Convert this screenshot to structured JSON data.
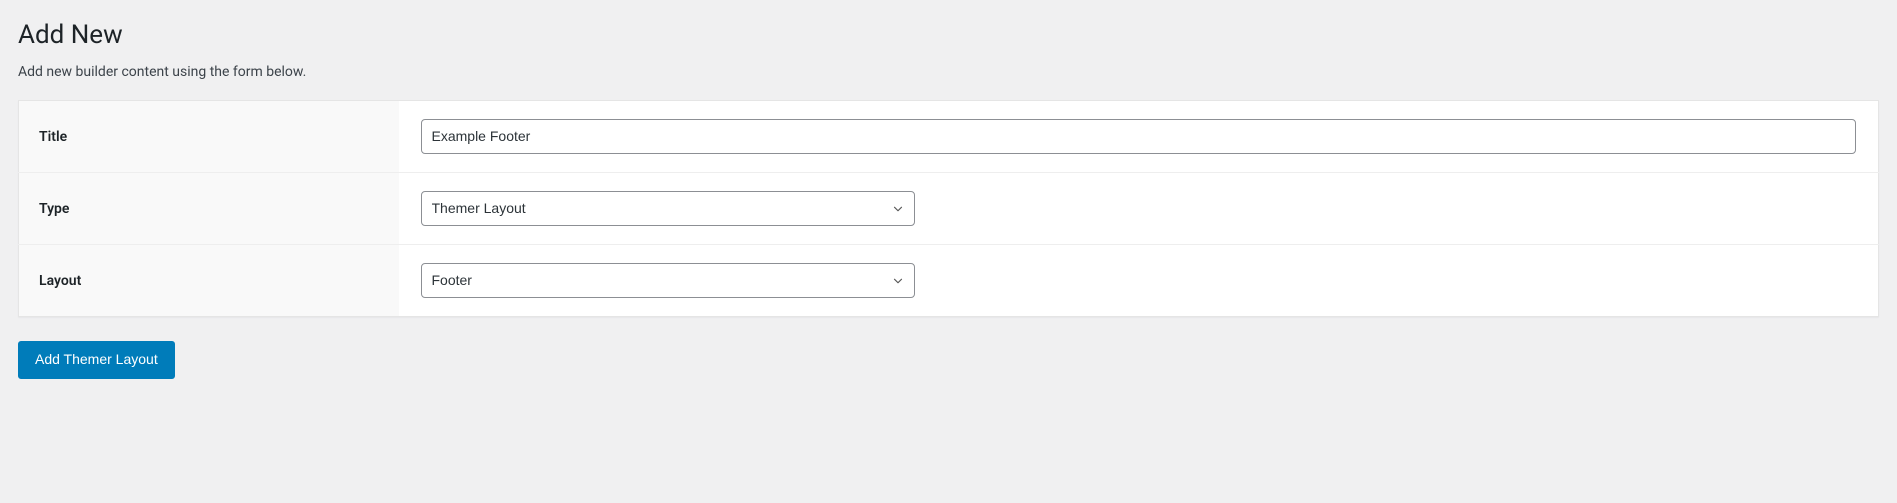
{
  "page": {
    "title": "Add New",
    "description": "Add new builder content using the form below."
  },
  "form": {
    "title": {
      "label": "Title",
      "value": "Example Footer"
    },
    "type": {
      "label": "Type",
      "selected": "Themer Layout"
    },
    "layout": {
      "label": "Layout",
      "selected": "Footer"
    }
  },
  "button": {
    "submit_label": "Add Themer Layout"
  }
}
